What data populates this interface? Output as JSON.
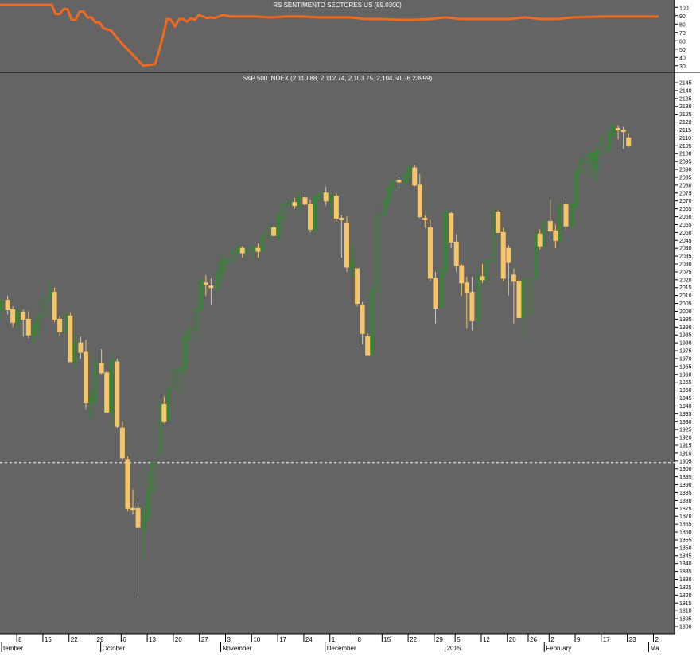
{
  "colors": {
    "background": "#646464",
    "up_candle": "#2e8b2e",
    "down_candle": "#f5c56a",
    "indicator_line": "#f26a1e",
    "text": "#ffffff",
    "axis_text": "#000000",
    "separator": "#000000",
    "dashed_line": "#ffffff"
  },
  "chart_data": [
    {
      "type": "line",
      "title": "RS SENTIMENTO SECTORES US (89.0300)",
      "ylim": [
        25,
        105
      ],
      "yticks": [
        100,
        90,
        80,
        70,
        60,
        50,
        40,
        30
      ],
      "x": [
        0,
        35,
        40,
        45,
        55,
        65,
        70,
        75,
        80,
        85,
        90,
        95,
        100,
        105,
        110,
        115,
        120,
        125,
        130,
        140,
        150,
        165,
        180,
        195,
        200,
        205,
        210,
        215,
        220,
        225,
        230,
        235,
        240,
        245,
        250,
        255,
        260,
        265,
        270,
        280,
        290,
        300,
        320,
        340,
        360,
        380,
        400,
        420,
        440,
        460,
        470,
        480,
        500,
        520,
        540,
        560,
        580,
        590,
        600,
        620,
        640,
        660,
        680,
        700,
        720,
        760,
        800,
        828
      ],
      "values": [
        103,
        103,
        103,
        103,
        103,
        103,
        92,
        92,
        98,
        98,
        85,
        85,
        95,
        95,
        88,
        88,
        82,
        82,
        75,
        72,
        60,
        45,
        30,
        32,
        48,
        66,
        86,
        85,
        77,
        86,
        86,
        83,
        87,
        85,
        91,
        89,
        87,
        88,
        87,
        91,
        89,
        89,
        89,
        88,
        89,
        89,
        88,
        88,
        88,
        86,
        86,
        86,
        85,
        85,
        86,
        88,
        86,
        86,
        86,
        86,
        86,
        88,
        86,
        86,
        88,
        89,
        89,
        89
      ]
    },
    {
      "type": "candlestick",
      "title": "S&P 500 INDEX (2,110.88, 2,112.74, 2,103.75, 2,104.50, -6.23999)",
      "ylim": [
        1800,
        2145
      ],
      "yticks": [
        2145,
        2140,
        2135,
        2130,
        2125,
        2120,
        2115,
        2110,
        2105,
        2100,
        2095,
        2090,
        2085,
        2080,
        2075,
        2070,
        2065,
        2060,
        2055,
        2050,
        2045,
        2040,
        2035,
        2030,
        2025,
        2020,
        2015,
        2010,
        2005,
        2000,
        1995,
        1990,
        1985,
        1980,
        1975,
        1970,
        1965,
        1960,
        1955,
        1950,
        1945,
        1940,
        1935,
        1930,
        1925,
        1920,
        1915,
        1910,
        1905,
        1900,
        1895,
        1890,
        1885,
        1880,
        1875,
        1870,
        1865,
        1860,
        1855,
        1850,
        1845,
        1840,
        1835,
        1830,
        1825,
        1820,
        1815,
        1810,
        1805,
        1800
      ],
      "reference_line": 1904,
      "candles": [
        {
          "open": 2001,
          "high": 2008,
          "low": 1995,
          "close": 2006
        },
        {
          "open": 2007,
          "high": 2010,
          "low": 1998,
          "close": 2001
        },
        {
          "open": 2001,
          "high": 2003,
          "low": 1990,
          "close": 1993
        },
        {
          "open": 1993,
          "high": 2001,
          "low": 1989,
          "close": 1999
        },
        {
          "open": 1999,
          "high": 2001,
          "low": 1984,
          "close": 1995
        },
        {
          "open": 1995,
          "high": 2000,
          "low": 1983,
          "close": 1985
        },
        {
          "open": 1985,
          "high": 1993,
          "low": 1980,
          "close": 1989
        },
        {
          "open": 1989,
          "high": 1999,
          "low": 1982,
          "close": 1996
        },
        {
          "open": 1996,
          "high": 2011,
          "low": 1990,
          "close": 2009
        },
        {
          "open": 2010,
          "high": 2020,
          "low": 2006,
          "close": 2012
        },
        {
          "open": 2012,
          "high": 2015,
          "low": 1993,
          "close": 1995
        },
        {
          "open": 1995,
          "high": 1997,
          "low": 1984,
          "close": 1987
        },
        {
          "open": 1987,
          "high": 2000,
          "low": 1970,
          "close": 1998
        },
        {
          "open": 1997,
          "high": 1999,
          "low": 1968,
          "close": 1968
        },
        {
          "open": 1968,
          "high": 1986,
          "low": 1964,
          "close": 1980
        },
        {
          "open": 1980,
          "high": 1984,
          "low": 1970,
          "close": 1974
        },
        {
          "open": 1974,
          "high": 1982,
          "low": 1938,
          "close": 1942
        },
        {
          "open": 1942,
          "high": 1950,
          "low": 1932,
          "close": 1944
        },
        {
          "open": 1944,
          "high": 1972,
          "low": 1940,
          "close": 1967
        },
        {
          "open": 1967,
          "high": 1976,
          "low": 1960,
          "close": 1961
        },
        {
          "open": 1961,
          "high": 1962,
          "low": 1936,
          "close": 1936
        },
        {
          "open": 1936,
          "high": 1973,
          "low": 1928,
          "close": 1968
        },
        {
          "open": 1968,
          "high": 1970,
          "low": 1926,
          "close": 1927
        },
        {
          "open": 1926,
          "high": 1930,
          "low": 1905,
          "close": 1907
        },
        {
          "open": 1906,
          "high": 1908,
          "low": 1873,
          "close": 1875
        },
        {
          "open": 1875,
          "high": 1887,
          "low": 1871,
          "close": 1874
        },
        {
          "open": 1875,
          "high": 1880,
          "low": 1821,
          "close": 1863
        },
        {
          "open": 1862,
          "high": 1878,
          "low": 1843,
          "close": 1870
        },
        {
          "open": 1870,
          "high": 1898,
          "low": 1867,
          "close": 1886
        },
        {
          "open": 1886,
          "high": 1905,
          "low": 1880,
          "close": 1904
        },
        {
          "open": 1910,
          "high": 1942,
          "low": 1908,
          "close": 1941
        },
        {
          "open": 1941,
          "high": 1946,
          "low": 1929,
          "close": 1930
        },
        {
          "open": 1932,
          "high": 1952,
          "low": 1930,
          "close": 1950
        },
        {
          "open": 1950,
          "high": 1964,
          "low": 1946,
          "close": 1963
        },
        {
          "open": 1963,
          "high": 1965,
          "low": 1949,
          "close": 1964
        },
        {
          "open": 1964,
          "high": 1987,
          "low": 1960,
          "close": 1983
        },
        {
          "open": 1983,
          "high": 1994,
          "low": 1980,
          "close": 1988
        },
        {
          "open": 1988,
          "high": 2007,
          "low": 1981,
          "close": 2002
        },
        {
          "open": 2002,
          "high": 2021,
          "low": 2000,
          "close": 2019
        },
        {
          "open": 2018,
          "high": 2023,
          "low": 2010,
          "close": 2017
        },
        {
          "open": 2016,
          "high": 2021,
          "low": 2004,
          "close": 2015
        },
        {
          "open": 2015,
          "high": 2029,
          "low": 2012,
          "close": 2024
        },
        {
          "open": 2024,
          "high": 2035,
          "low": 2019,
          "close": 2031
        },
        {
          "open": 2031,
          "high": 2035,
          "low": 2025,
          "close": 2032
        },
        {
          "open": 2032,
          "high": 2039,
          "low": 2030,
          "close": 2038
        },
        {
          "open": 2038,
          "high": 2042,
          "low": 2035,
          "close": 2040
        },
        {
          "open": 2040,
          "high": 2041,
          "low": 2034,
          "close": 2037
        },
        {
          "open": 2037,
          "high": 2041,
          "low": 2032,
          "close": 2039
        },
        {
          "open": 2039,
          "high": 2042,
          "low": 2033,
          "close": 2041
        },
        {
          "open": 2040,
          "high": 2043,
          "low": 2034,
          "close": 2038
        },
        {
          "open": 2039,
          "high": 2048,
          "low": 2036,
          "close": 2047
        },
        {
          "open": 2047,
          "high": 2056,
          "low": 2042,
          "close": 2053
        },
        {
          "open": 2053,
          "high": 2054,
          "low": 2048,
          "close": 2048
        },
        {
          "open": 2048,
          "high": 2062,
          "low": 2045,
          "close": 2059
        },
        {
          "open": 2059,
          "high": 2071,
          "low": 2054,
          "close": 2068
        },
        {
          "open": 2068,
          "high": 2071,
          "low": 2063,
          "close": 2069
        },
        {
          "open": 2069,
          "high": 2072,
          "low": 2065,
          "close": 2067
        },
        {
          "open": 2067,
          "high": 2075,
          "low": 2062,
          "close": 2072
        },
        {
          "open": 2072,
          "high": 2076,
          "low": 2067,
          "close": 2068
        },
        {
          "open": 2068,
          "high": 2071,
          "low": 2050,
          "close": 2052
        },
        {
          "open": 2052,
          "high": 2075,
          "low": 2049,
          "close": 2072
        },
        {
          "open": 2072,
          "high": 2076,
          "low": 2068,
          "close": 2075
        },
        {
          "open": 2075,
          "high": 2079,
          "low": 2067,
          "close": 2070
        },
        {
          "open": 2070,
          "high": 2075,
          "low": 2060,
          "close": 2073
        },
        {
          "open": 2073,
          "high": 2075,
          "low": 2057,
          "close": 2059
        },
        {
          "open": 2059,
          "high": 2061,
          "low": 2034,
          "close": 2058
        },
        {
          "open": 2056,
          "high": 2060,
          "low": 2025,
          "close": 2028
        },
        {
          "open": 2028,
          "high": 2041,
          "low": 2022,
          "close": 2031
        },
        {
          "open": 2027,
          "high": 2027,
          "low": 2003,
          "close": 2005
        },
        {
          "open": 2004,
          "high": 2006,
          "low": 1979,
          "close": 1986
        },
        {
          "open": 1984,
          "high": 1986,
          "low": 1972,
          "close": 1972
        },
        {
          "open": 1973,
          "high": 2016,
          "low": 1973,
          "close": 2013
        },
        {
          "open": 2013,
          "high": 2063,
          "low": 2013,
          "close": 2061
        },
        {
          "open": 2061,
          "high": 2071,
          "low": 2058,
          "close": 2070
        },
        {
          "open": 2070,
          "high": 2080,
          "low": 2067,
          "close": 2078
        },
        {
          "open": 2078,
          "high": 2083,
          "low": 2075,
          "close": 2083
        },
        {
          "open": 2083,
          "high": 2085,
          "low": 2078,
          "close": 2082
        },
        {
          "open": 2082,
          "high": 2089,
          "low": 2079,
          "close": 2086
        },
        {
          "open": 2086,
          "high": 2093,
          "low": 2082,
          "close": 2091
        },
        {
          "open": 2091,
          "high": 2093,
          "low": 2079,
          "close": 2080
        },
        {
          "open": 2080,
          "high": 2087,
          "low": 2059,
          "close": 2060
        },
        {
          "open": 2059,
          "high": 2061,
          "low": 2053,
          "close": 2058
        },
        {
          "open": 2053,
          "high": 2058,
          "low": 2019,
          "close": 2021
        },
        {
          "open": 2021,
          "high": 2025,
          "low": 1992,
          "close": 2002
        },
        {
          "open": 2003,
          "high": 2028,
          "low": 2003,
          "close": 2026
        },
        {
          "open": 2026,
          "high": 2065,
          "low": 2024,
          "close": 2062
        },
        {
          "open": 2062,
          "high": 2063,
          "low": 2040,
          "close": 2044
        },
        {
          "open": 2044,
          "high": 2049,
          "low": 2025,
          "close": 2029
        },
        {
          "open": 2029,
          "high": 2030,
          "low": 2010,
          "close": 2018
        },
        {
          "open": 2018,
          "high": 2022,
          "low": 1989,
          "close": 2012
        },
        {
          "open": 2012,
          "high": 2022,
          "low": 1988,
          "close": 1994
        },
        {
          "open": 1994,
          "high": 2025,
          "low": 1990,
          "close": 2022
        },
        {
          "open": 2022,
          "high": 2030,
          "low": 2018,
          "close": 2020
        },
        {
          "open": 2020,
          "high": 2033,
          "low": 2017,
          "close": 2032
        },
        {
          "open": 2032,
          "high": 2065,
          "low": 2029,
          "close": 2063
        },
        {
          "open": 2063,
          "high": 2064,
          "low": 2050,
          "close": 2050
        },
        {
          "open": 2050,
          "high": 2053,
          "low": 2019,
          "close": 2021
        },
        {
          "open": 2040,
          "high": 2042,
          "low": 2010,
          "close": 2031
        },
        {
          "open": 2023,
          "high": 2027,
          "low": 1992,
          "close": 2019
        },
        {
          "open": 2019,
          "high": 2020,
          "low": 1996,
          "close": 1996
        },
        {
          "open": 1996,
          "high": 2021,
          "low": 1982,
          "close": 2020
        },
        {
          "open": 1999,
          "high": 2022,
          "low": 1981,
          "close": 2021
        },
        {
          "open": 2021,
          "high": 2050,
          "low": 2021,
          "close": 2049
        },
        {
          "open": 2049,
          "high": 2052,
          "low": 2039,
          "close": 2041
        },
        {
          "open": 2042,
          "high": 2059,
          "low": 2040,
          "close": 2057
        },
        {
          "open": 2057,
          "high": 2071,
          "low": 2050,
          "close": 2051
        },
        {
          "open": 2051,
          "high": 2055,
          "low": 2040,
          "close": 2045
        },
        {
          "open": 2045,
          "high": 2068,
          "low": 2044,
          "close": 2067
        },
        {
          "open": 2068,
          "high": 2072,
          "low": 2052,
          "close": 2054
        },
        {
          "open": 2055,
          "high": 2069,
          "low": 2052,
          "close": 2068
        },
        {
          "open": 2068,
          "high": 2090,
          "low": 2066,
          "close": 2088
        },
        {
          "open": 2088,
          "high": 2097,
          "low": 2085,
          "close": 2096
        },
        {
          "open": 2094,
          "high": 2100,
          "low": 2086,
          "close": 2099
        },
        {
          "open": 2096,
          "high": 2101,
          "low": 2085,
          "close": 2100
        },
        {
          "open": 2090,
          "high": 2106,
          "low": 2082,
          "close": 2101
        },
        {
          "open": 2100,
          "high": 2111,
          "low": 2092,
          "close": 2110
        },
        {
          "open": 2102,
          "high": 2118,
          "low": 2101,
          "close": 2113
        },
        {
          "open": 2113,
          "high": 2119,
          "low": 2110,
          "close": 2117
        },
        {
          "open": 2116,
          "high": 2118,
          "low": 2109,
          "close": 2115
        },
        {
          "open": 2115,
          "high": 2117,
          "low": 2103,
          "close": 2114
        },
        {
          "open": 2110,
          "high": 2113,
          "low": 2104,
          "close": 2105
        }
      ],
      "x_ticks": [
        "8",
        "15",
        "22",
        "29",
        "6",
        "13",
        "20",
        "27",
        "3",
        "10",
        "17",
        "24",
        "1",
        "8",
        "15",
        "22",
        "29",
        "5",
        "12",
        "20",
        "26",
        "2",
        "9",
        "17",
        "23",
        "2"
      ],
      "x_tick_positions": [
        2,
        7,
        12,
        17,
        22,
        27,
        32,
        37,
        42,
        47,
        52,
        57,
        62,
        67,
        72,
        77,
        82,
        86,
        91,
        96,
        100,
        104,
        109,
        114,
        119,
        124
      ],
      "months": [
        "tember",
        "October",
        "November",
        "December",
        "2015",
        "February",
        "Ma"
      ],
      "month_positions": [
        0,
        19,
        42,
        62,
        85,
        104,
        124
      ]
    }
  ]
}
